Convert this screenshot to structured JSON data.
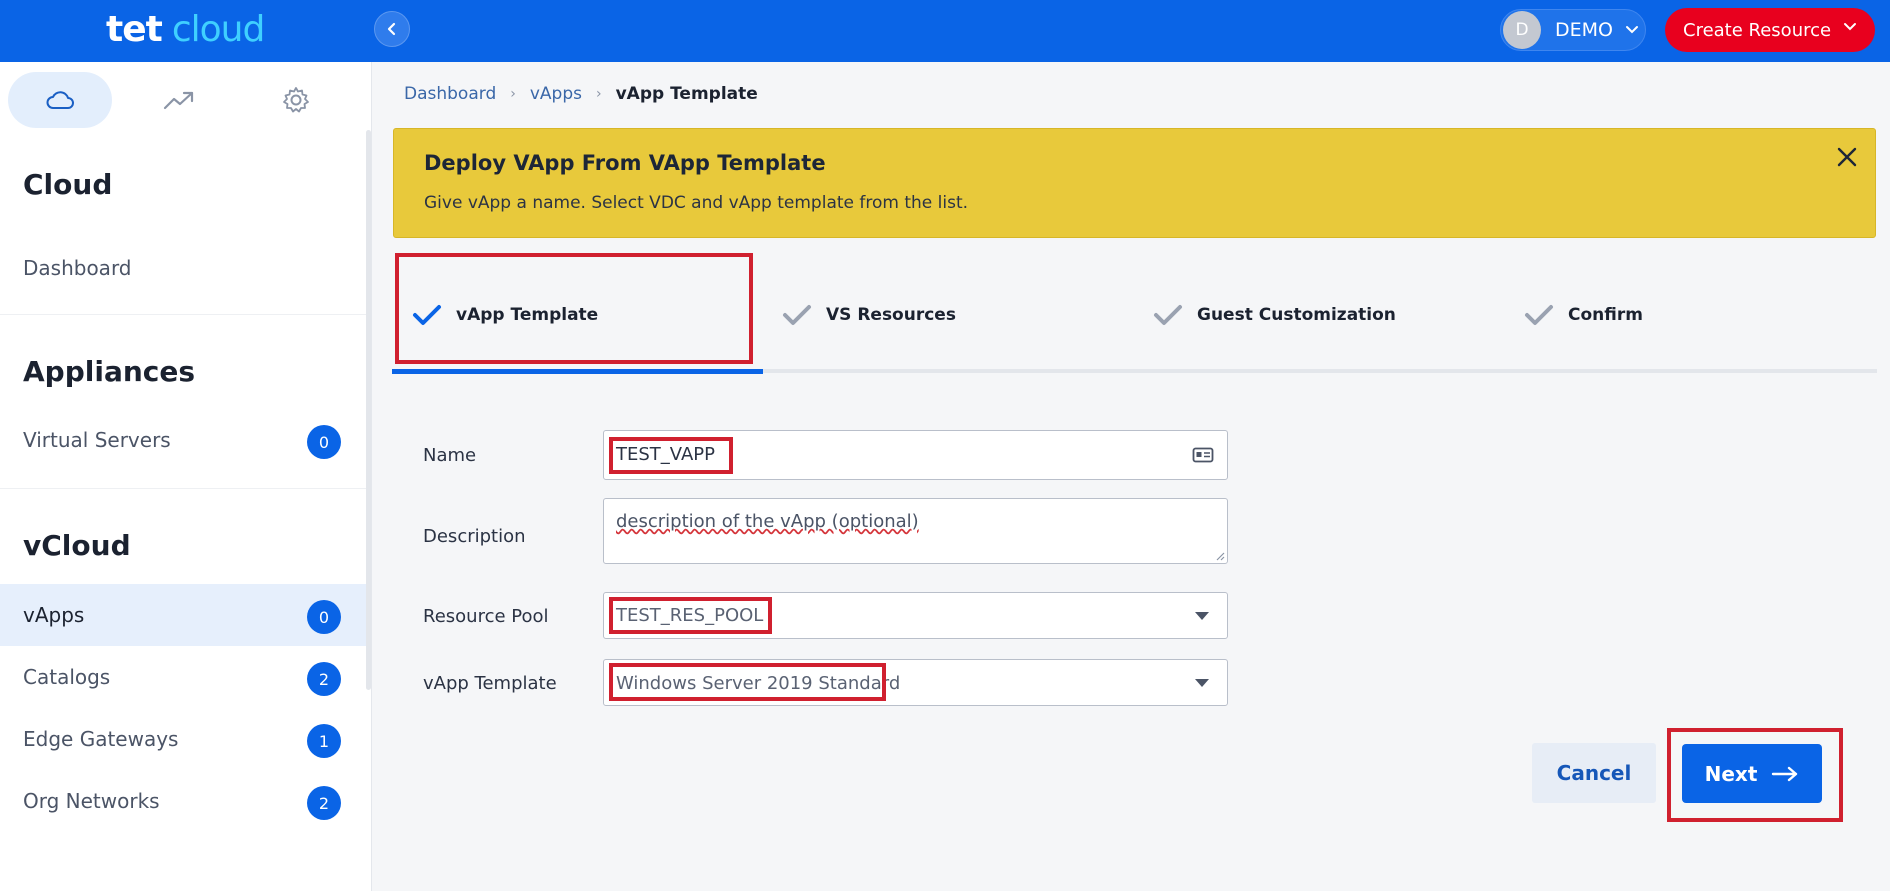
{
  "brand": {
    "logo_part1": "tet",
    "logo_part2": "cloud"
  },
  "header": {
    "user_initial": "D",
    "user_name": "DEMO",
    "create_label": "Create Resource"
  },
  "sidebar": {
    "tabs": [
      "cloud-icon",
      "trend-icon",
      "gear-icon"
    ],
    "sections": [
      {
        "title": "Cloud",
        "items": [
          {
            "label": "Dashboard"
          }
        ]
      },
      {
        "title": "Appliances",
        "items": [
          {
            "label": "Virtual Servers",
            "count": "0"
          }
        ]
      },
      {
        "title": "vCloud",
        "items": [
          {
            "label": "vApps",
            "count": "0",
            "active": true
          },
          {
            "label": "Catalogs",
            "count": "2"
          },
          {
            "label": "Edge Gateways",
            "count": "1"
          },
          {
            "label": "Org Networks",
            "count": "2"
          }
        ]
      }
    ]
  },
  "breadcrumb": [
    "Dashboard",
    "vApps",
    "vApp Template"
  ],
  "banner": {
    "title": "Deploy VApp From VApp Template",
    "text": "Give vApp a name. Select VDC and vApp template from the list."
  },
  "steps": [
    "vApp Template",
    "VS Resources",
    "Guest Customization",
    "Confirm"
  ],
  "form": {
    "name": {
      "label": "Name",
      "value": "TEST_VAPP"
    },
    "description": {
      "label": "Description",
      "value": "description of the vApp (optional)"
    },
    "resource_pool": {
      "label": "Resource Pool",
      "value": "TEST_RES_POOL"
    },
    "vapp_template": {
      "label": "vApp Template",
      "value": "Windows Server 2019 Standard"
    }
  },
  "actions": {
    "cancel": "Cancel",
    "next": "Next"
  },
  "colors": {
    "primary": "#0a64e6",
    "danger": "#e8001e",
    "banner": "#e8c93b",
    "highlight": "#d0202f"
  }
}
